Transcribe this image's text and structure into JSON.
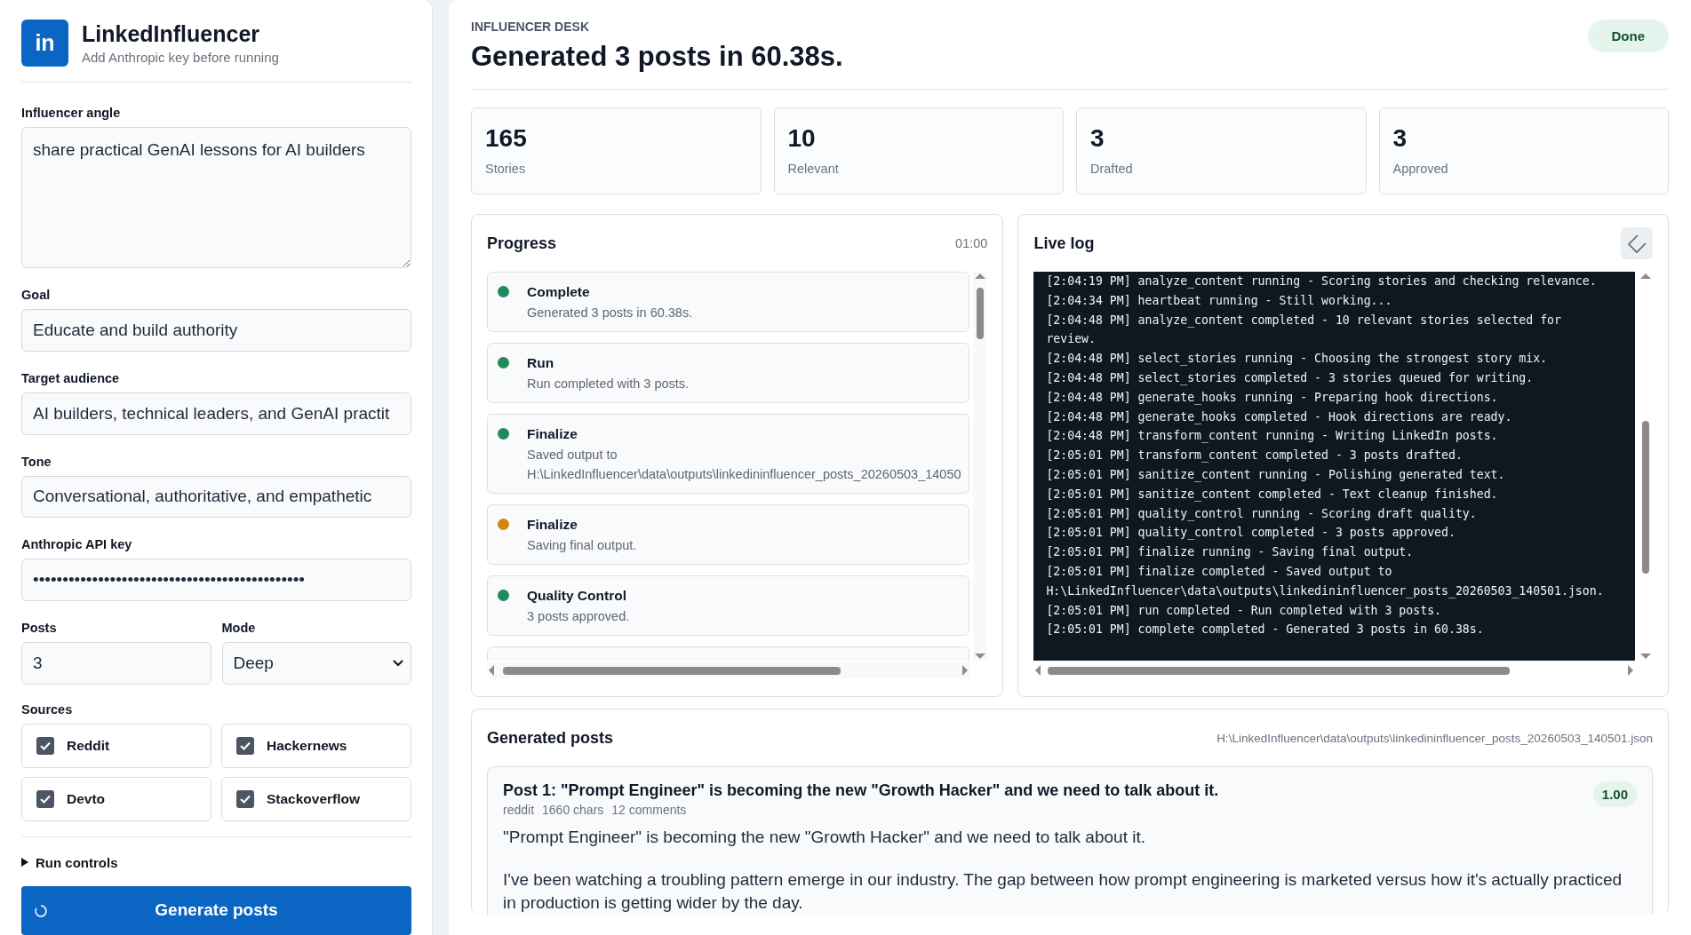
{
  "sidebar": {
    "logo": "in",
    "app_name": "LinkedInfluencer",
    "subtitle": "Add Anthropic key before running",
    "fields": [
      {
        "label": "Influencer angle",
        "kind": "textarea",
        "value": "share practical GenAI lessons for AI builders"
      },
      {
        "label": "Goal",
        "kind": "text",
        "value": "Educate and build authority"
      },
      {
        "label": "Target audience",
        "kind": "text",
        "value": "AI builders, technical leaders, and GenAI practit"
      },
      {
        "label": "Tone",
        "kind": "text",
        "value": "Conversational, authoritative, and empathetic"
      },
      {
        "label": "Anthropic API key",
        "kind": "text",
        "value": "••••••••••••••••••••••••••••••••••••••••••••••"
      }
    ],
    "posts": {
      "label": "Posts",
      "value": "3"
    },
    "mode": {
      "label": "Mode",
      "value": "Deep"
    },
    "sources_label": "Sources",
    "sources": [
      {
        "label": "Reddit",
        "checked": true
      },
      {
        "label": "Hackernews",
        "checked": true
      },
      {
        "label": "Devto",
        "checked": true
      },
      {
        "label": "Stackoverflow",
        "checked": true
      }
    ],
    "run_controls": {
      "label": "Run controls",
      "expanded": false
    },
    "generate_button": {
      "label": "Generate posts",
      "busy": true
    }
  },
  "header": {
    "eyebrow": "INFLUENCER DESK",
    "title": "Generated 3 posts in 60.38s.",
    "status": "Done"
  },
  "stats": [
    {
      "value": "165",
      "label": "Stories"
    },
    {
      "value": "10",
      "label": "Relevant"
    },
    {
      "value": "3",
      "label": "Drafted"
    },
    {
      "value": "3",
      "label": "Approved"
    }
  ],
  "progress": {
    "title": "Progress",
    "elapsed": "01:00",
    "steps": [
      {
        "name": "Complete",
        "detail": "Generated 3 posts in 60.38s.",
        "color": "#1f8a5b"
      },
      {
        "name": "Run",
        "detail": "Run completed with 3 posts.",
        "color": "#1f8a5b"
      },
      {
        "name": "Finalize",
        "detail": "Saved output to",
        "detail_2": "H:\\LinkedInfluencer\\data\\outputs\\linkedininfluencer_posts_20260503_14050",
        "color": "#1f8a5b"
      },
      {
        "name": "Finalize",
        "detail": "Saving final output.",
        "color": "#d08a0a"
      },
      {
        "name": "Quality Control",
        "detail": "3 posts approved.",
        "color": "#1f8a5b"
      }
    ]
  },
  "live_log": {
    "title": "Live log",
    "lines": [
      "[2:04:19 PM] analyze_content running - Scoring stories and checking relevance.",
      "[2:04:34 PM] heartbeat running - Still working...",
      "[2:04:48 PM] analyze_content completed - 10 relevant stories selected for review.",
      "[2:04:48 PM] select_stories running - Choosing the strongest story mix.",
      "[2:04:48 PM] select_stories completed - 3 stories queued for writing.",
      "[2:04:48 PM] generate_hooks running - Preparing hook directions.",
      "[2:04:48 PM] generate_hooks completed - Hook directions are ready.",
      "[2:04:48 PM] transform_content running - Writing LinkedIn posts.",
      "[2:05:01 PM] transform_content completed - 3 posts drafted.",
      "[2:05:01 PM] sanitize_content running - Polishing generated text.",
      "[2:05:01 PM] sanitize_content completed - Text cleanup finished.",
      "[2:05:01 PM] quality_control running - Scoring draft quality.",
      "[2:05:01 PM] quality_control completed - 3 posts approved.",
      "[2:05:01 PM] finalize running - Saving final output.",
      "[2:05:01 PM] finalize completed - Saved output to H:\\LinkedInfluencer\\data\\outputs\\linkedininfluencer_posts_20260503_140501.json.",
      "[2:05:01 PM] run completed - Run completed with 3 posts.",
      "[2:05:01 PM] complete completed - Generated 3 posts in 60.38s."
    ]
  },
  "generated_posts": {
    "title": "Generated posts",
    "path": "H:\\LinkedInfluencer\\data\\outputs\\linkedininfluencer_posts_20260503_140501.json",
    "posts": [
      {
        "title": "Post 1: \"Prompt Engineer\" is becoming the new \"Growth Hacker\" and we need to talk about it.",
        "source": "reddit",
        "chars": "1660 chars",
        "comments": "12 comments",
        "score": "1.00",
        "paragraphs": [
          "\"Prompt Engineer\" is becoming the new \"Growth Hacker\" and we need to talk about it.",
          "I've been watching a troubling pattern emerge in our industry. The gap between how prompt engineering is marketed versus how it's actually practiced in production is getting wider by the day."
        ]
      }
    ]
  }
}
